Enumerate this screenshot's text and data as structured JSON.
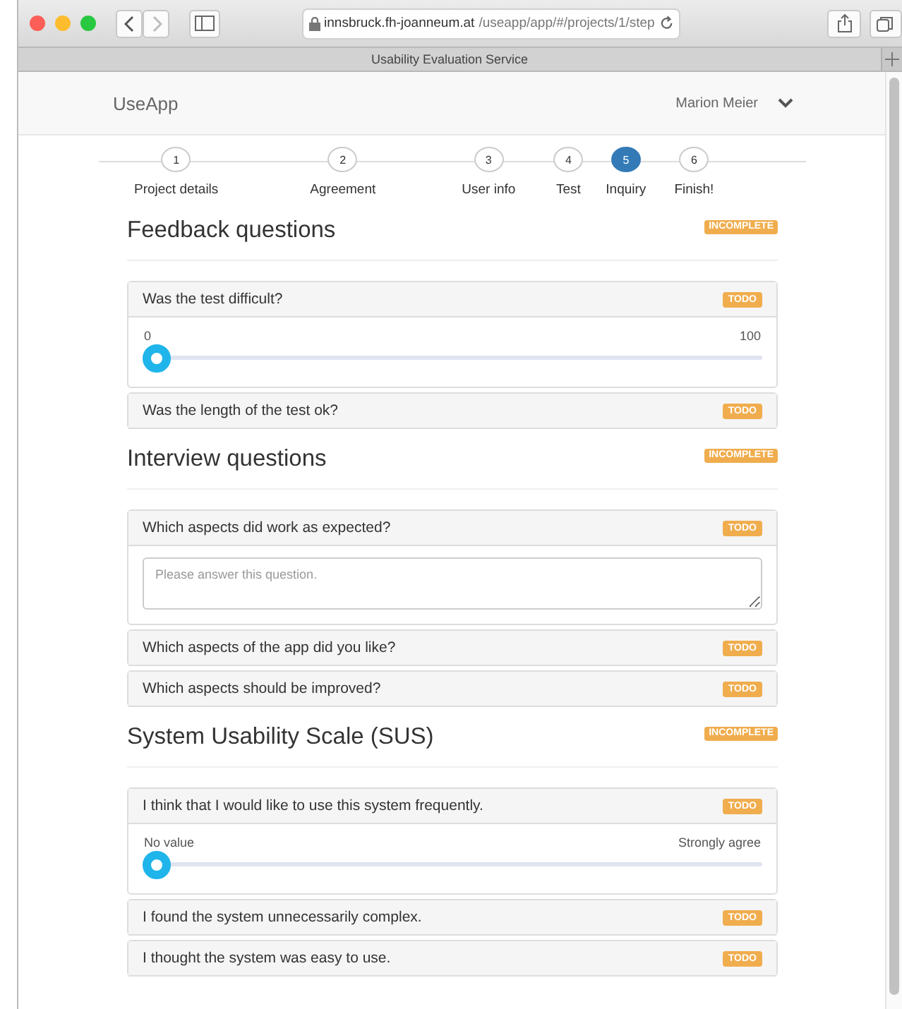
{
  "browser": {
    "url_host": "innsbruck.fh-joanneum.at",
    "url_path": "/useapp/app/#/projects/1/step",
    "tab_title": "Usability Evaluation Service"
  },
  "navbar": {
    "brand": "UseApp",
    "user": "Marion Meier"
  },
  "steps": [
    {
      "number": "1",
      "label": "Project details",
      "selected": false
    },
    {
      "number": "2",
      "label": "Agreement",
      "selected": false
    },
    {
      "number": "3",
      "label": "User info",
      "selected": false
    },
    {
      "number": "4",
      "label": "Test",
      "selected": false
    },
    {
      "number": "5",
      "label": "Inquiry",
      "selected": true
    },
    {
      "number": "6",
      "label": "Finish!",
      "selected": false
    }
  ],
  "sections": [
    {
      "title": "Feedback questions",
      "status": "INCOMPLETE",
      "questions": [
        {
          "kind": "slider",
          "text": "Was the test difficult?",
          "badge": "TODO",
          "min_label": "0",
          "max_label": "100",
          "level": 0
        },
        {
          "kind": "collapsed",
          "text": "Was the length of the test ok?",
          "badge": "TODO"
        }
      ]
    },
    {
      "title": "Interview questions",
      "status": "INCOMPLETE",
      "questions": [
        {
          "kind": "text",
          "text": "Which aspects did work as expected?",
          "badge": "TODO",
          "placeholder": "Please answer this question."
        },
        {
          "kind": "collapsed",
          "text": "Which aspects of the app did you like?",
          "badge": "TODO"
        },
        {
          "kind": "collapsed",
          "text": "Which aspects should be improved?",
          "badge": "TODO"
        }
      ]
    },
    {
      "title": "System Usability Scale (SUS)",
      "status": "INCOMPLETE",
      "questions": [
        {
          "kind": "slider",
          "text": "I think that I would like to use this system frequently.",
          "badge": "TODO",
          "min_label": "No value",
          "max_label": "Strongly agree",
          "level": 0
        },
        {
          "kind": "collapsed",
          "text": "I found the system unnecessarily complex.",
          "badge": "TODO"
        },
        {
          "kind": "collapsed",
          "text": "I thought the system was easy to use.",
          "badge": "TODO"
        }
      ]
    }
  ]
}
